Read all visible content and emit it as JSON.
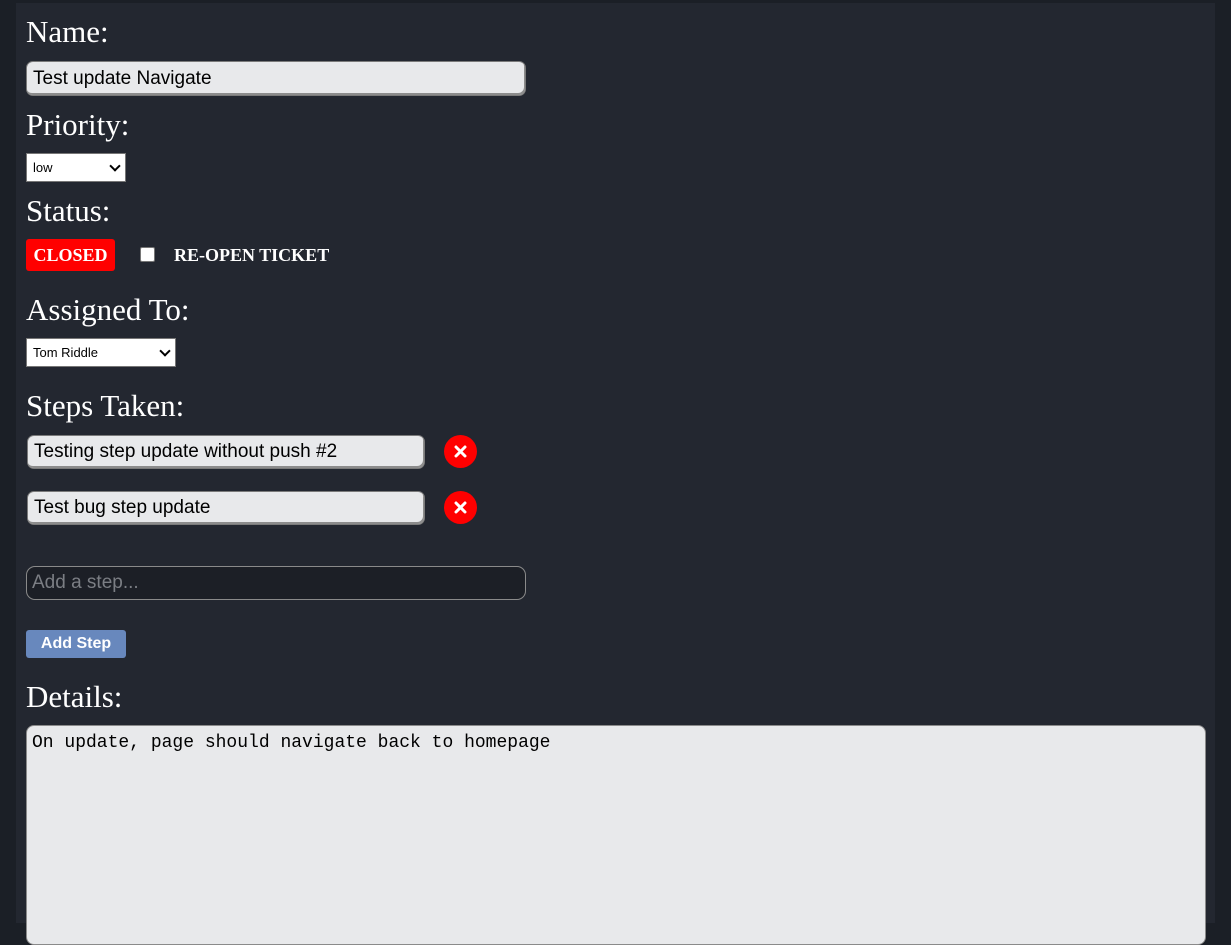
{
  "form": {
    "name_label": "Name:",
    "name_value": "Test update Navigate",
    "priority_label": "Priority:",
    "priority_selected": "low",
    "status_label": "Status:",
    "status_badge": "CLOSED",
    "reopen_label": "RE-OPEN TICKET",
    "reopen_checked": false,
    "assigned_label": "Assigned To:",
    "assigned_selected": "Tom Riddle",
    "steps_label": "Steps Taken:",
    "steps": [
      {
        "value": "Testing step update without push #2"
      },
      {
        "value": "Test bug step update"
      }
    ],
    "add_step_placeholder": "Add a step...",
    "add_step_button": "Add Step",
    "details_label": "Details:",
    "details_value": "On update, page should navigate back to homepage"
  },
  "colors": {
    "background": "#232730",
    "status_closed": "#ff0000",
    "delete_button": "#ff0000",
    "add_step_button": "#6888bd",
    "input_fill": "#e8e9eb"
  },
  "icons": {
    "delete": "close-icon",
    "select_arrow": "chevron-down-icon"
  }
}
